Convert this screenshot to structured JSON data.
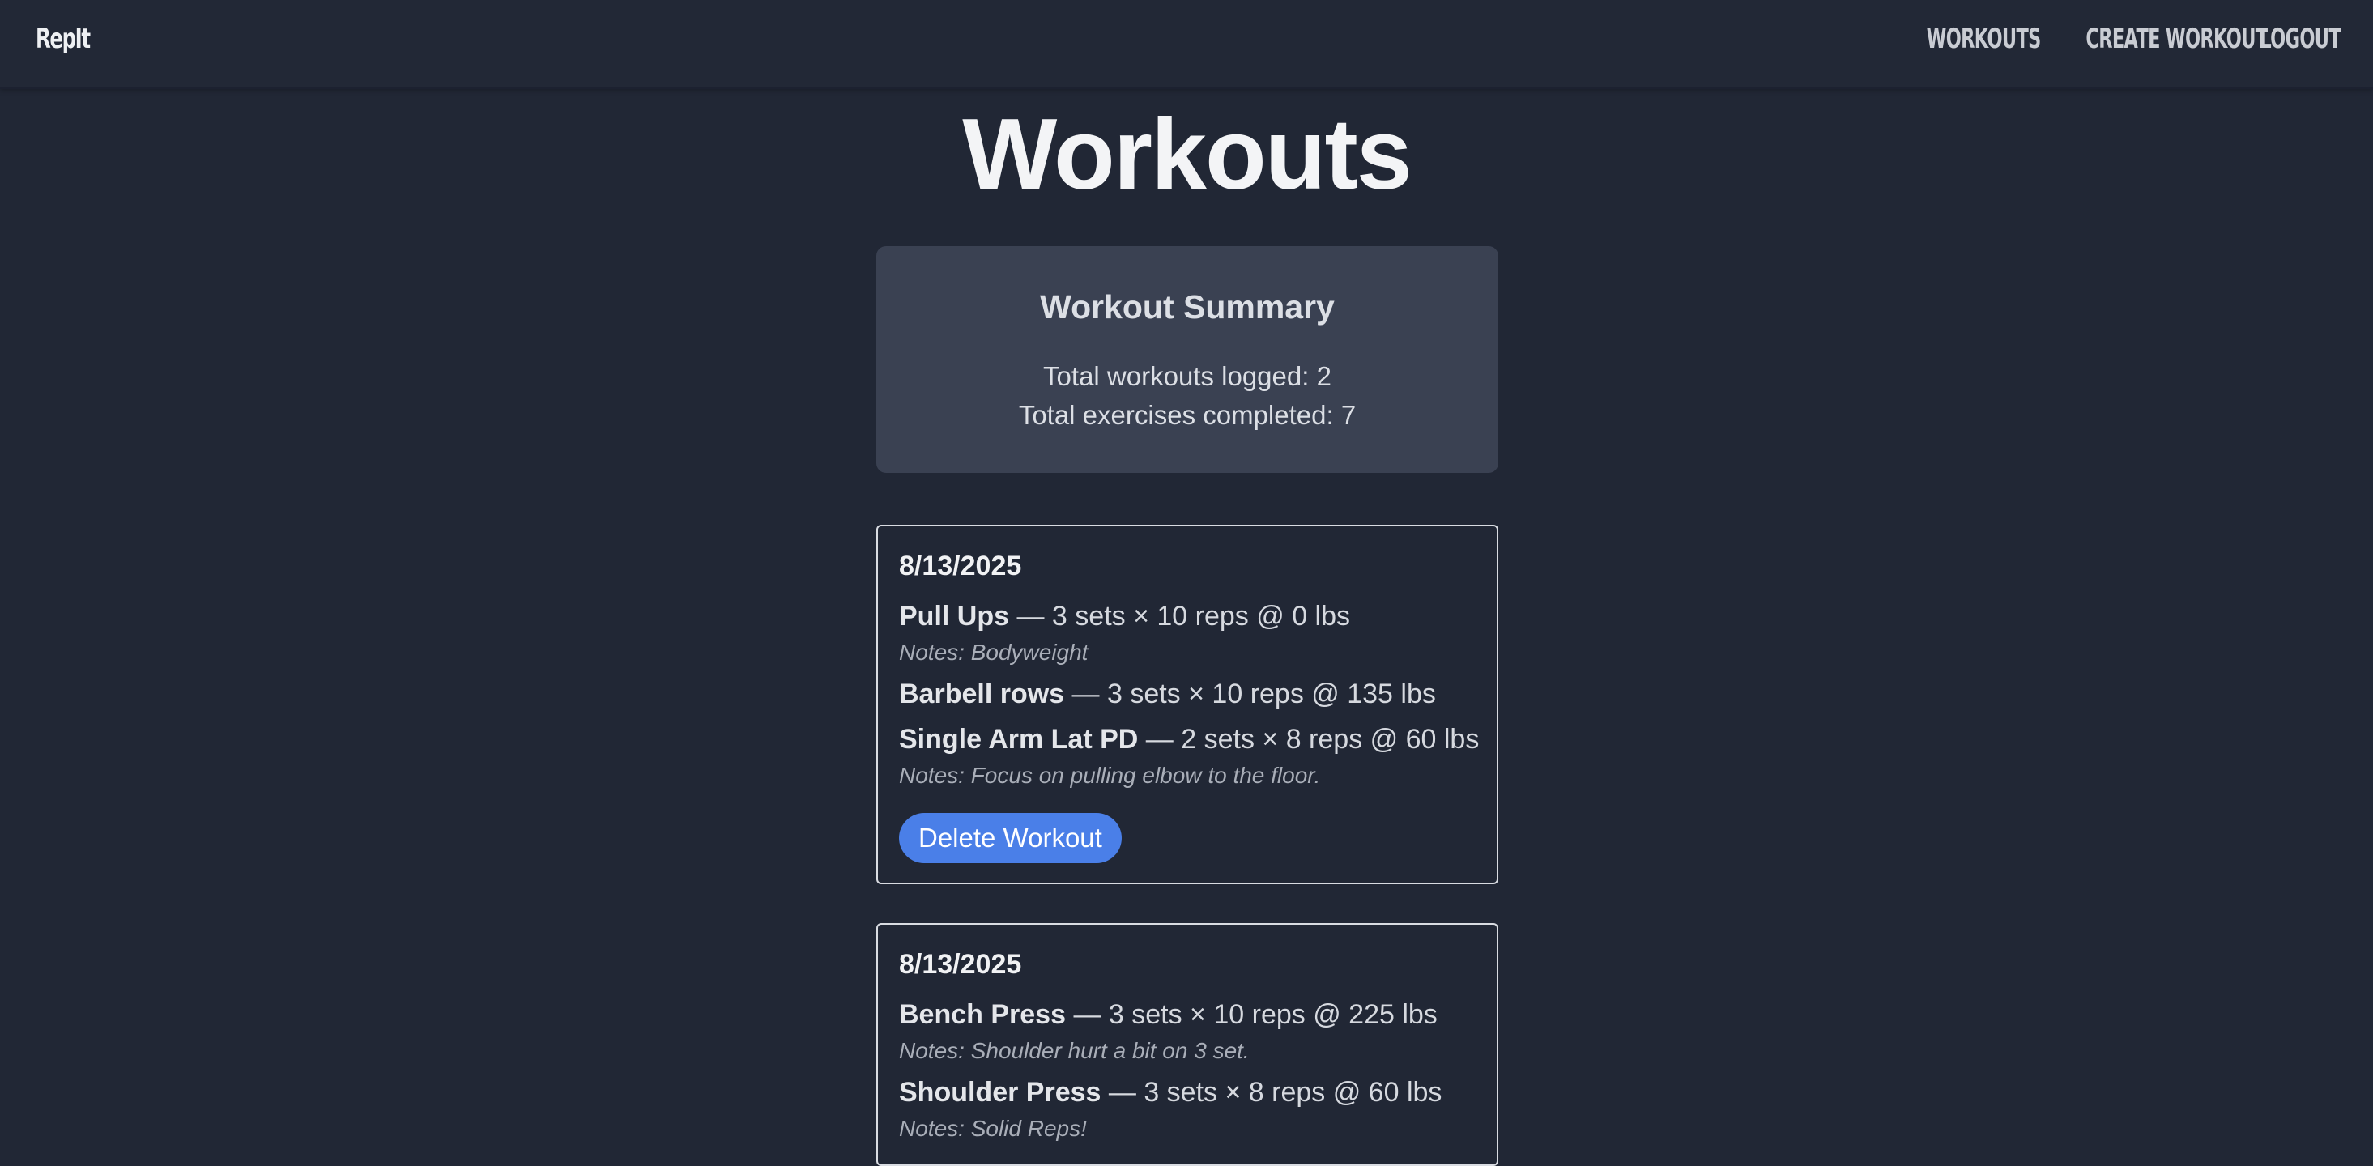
{
  "nav": {
    "brand": "RepIt",
    "links": [
      "Workouts",
      "Create Workout",
      "Logout"
    ]
  },
  "page": {
    "title": "Workouts"
  },
  "summary": {
    "heading": "Workout Summary",
    "total_workouts": "Total workouts logged: 2",
    "total_exercises": "Total exercises completed: 7"
  },
  "workouts": [
    {
      "date": "8/13/2025",
      "exercises": [
        {
          "name": "Pull Ups",
          "detail": " — 3 sets × 10 reps @ 0 lbs",
          "notes": "Notes: Bodyweight"
        },
        {
          "name": "Barbell rows",
          "detail": " — 3 sets × 10 reps @ 135 lbs",
          "notes": ""
        },
        {
          "name": "Single Arm Lat PD",
          "detail": " — 2 sets × 8 reps @ 60 lbs",
          "notes": "Notes: Focus on pulling elbow to the floor."
        }
      ],
      "delete_label": "Delete Workout"
    },
    {
      "date": "8/13/2025",
      "exercises": [
        {
          "name": "Bench Press",
          "detail": " — 3 sets × 10 reps @ 225 lbs",
          "notes": "Notes: Shoulder hurt a bit on 3 set."
        },
        {
          "name": "Shoulder Press",
          "detail": " — 3 sets × 8 reps @ 60 lbs",
          "notes": "Notes: Solid Reps!"
        }
      ]
    }
  ],
  "colors": {
    "background": "#212735",
    "summary_bg": "#3a4152",
    "button": "#4a7fe8"
  }
}
